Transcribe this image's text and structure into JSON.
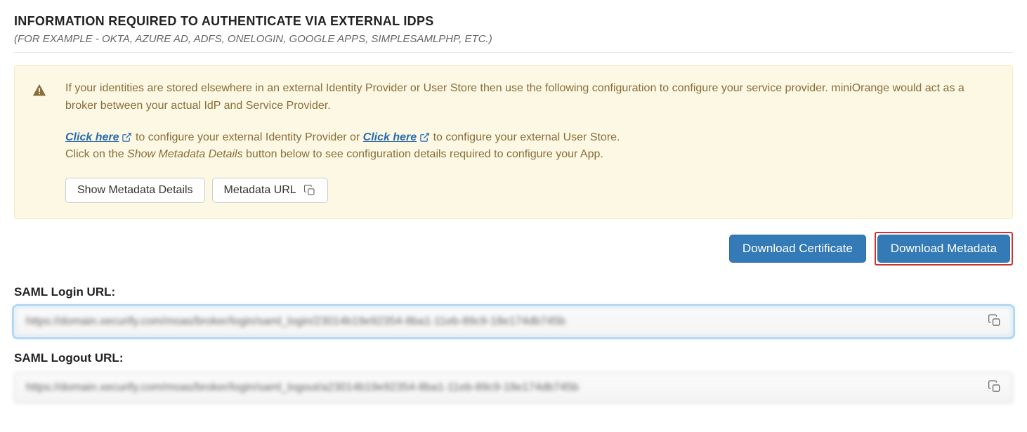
{
  "header": {
    "title": "INFORMATION REQUIRED TO AUTHENTICATE VIA EXTERNAL IDPS",
    "subtitle": "(FOR EXAMPLE - OKTA, AZURE AD, ADFS, ONELOGIN, GOOGLE APPS, SIMPLESAMLPHP, ETC.)"
  },
  "alert": {
    "line1": "If your identities are stored elsewhere in an external Identity Provider or User Store then use the following configuration to configure your service provider.",
    "line2": "miniOrange would act as a broker between your actual IdP and Service Provider.",
    "link1_text": "Click here",
    "line3_mid": " to configure your external Identity Provider or ",
    "link2_text": "Click here",
    "line3_end": " to configure your external User Store.",
    "line4_a": "Click on the ",
    "line4_italic": "Show Metadata Details",
    "line4_b": " button below to see configuration details required to configure your App.",
    "btn_show_metadata": "Show Metadata Details",
    "btn_metadata_url": "Metadata URL"
  },
  "actions": {
    "download_cert": "Download Certificate",
    "download_meta": "Download Metadata"
  },
  "fields": {
    "saml_login_label": "SAML Login URL:",
    "saml_login_value": "https://domain.xecurify.com/moas/broker/login/saml_login/23014b19e92354-8ba1-11eb-89c9-18e174db745b",
    "saml_logout_label": "SAML Logout URL:",
    "saml_logout_value": "https://domain.xecurify.com/moas/broker/login/saml_logout/a23014b19e92354-8ba1-11eb-89c9-18e174db745b"
  }
}
